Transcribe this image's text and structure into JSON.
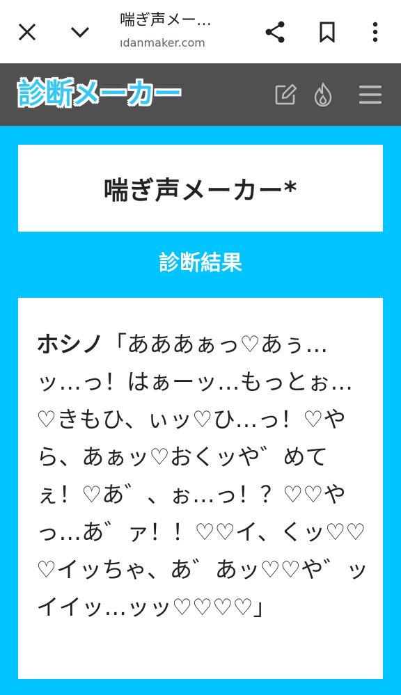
{
  "browser": {
    "tab_title": "喘ぎ声メー…",
    "url": "ıdanmaker.com",
    "icons": [
      "close-icon",
      "chevron-down-icon",
      "share-icon",
      "bookmark-icon",
      "more-vert-icon"
    ]
  },
  "site": {
    "logo_text": "診断メーカー",
    "header_icons": [
      "edit-icon",
      "fire-icon",
      "hamburger-menu-icon"
    ],
    "colors": {
      "background": "#00c4ff",
      "header": "#505050",
      "logo": "#35c8f5"
    }
  },
  "title_card": {
    "title": "喘ぎ声メーカー*"
  },
  "section": {
    "heading": "診断結果"
  },
  "result": {
    "name": "ホシノ",
    "text": "「あああぁっ♡あぅ…ッ…っ！はぁーッ…もっとぉ…♡きもひ、ぃッ♡ひ…っ！♡やら、あぁッ♡おくッや゛めてぇ！♡あ゛、ぉ…っ！？♡♡やっ…あ゛ァ！！♡♡イ、くッ♡♡♡イッちゃ、あ゛あッ♡♡や゛ッイイッ…ッッ♡♡♡♡」"
  }
}
